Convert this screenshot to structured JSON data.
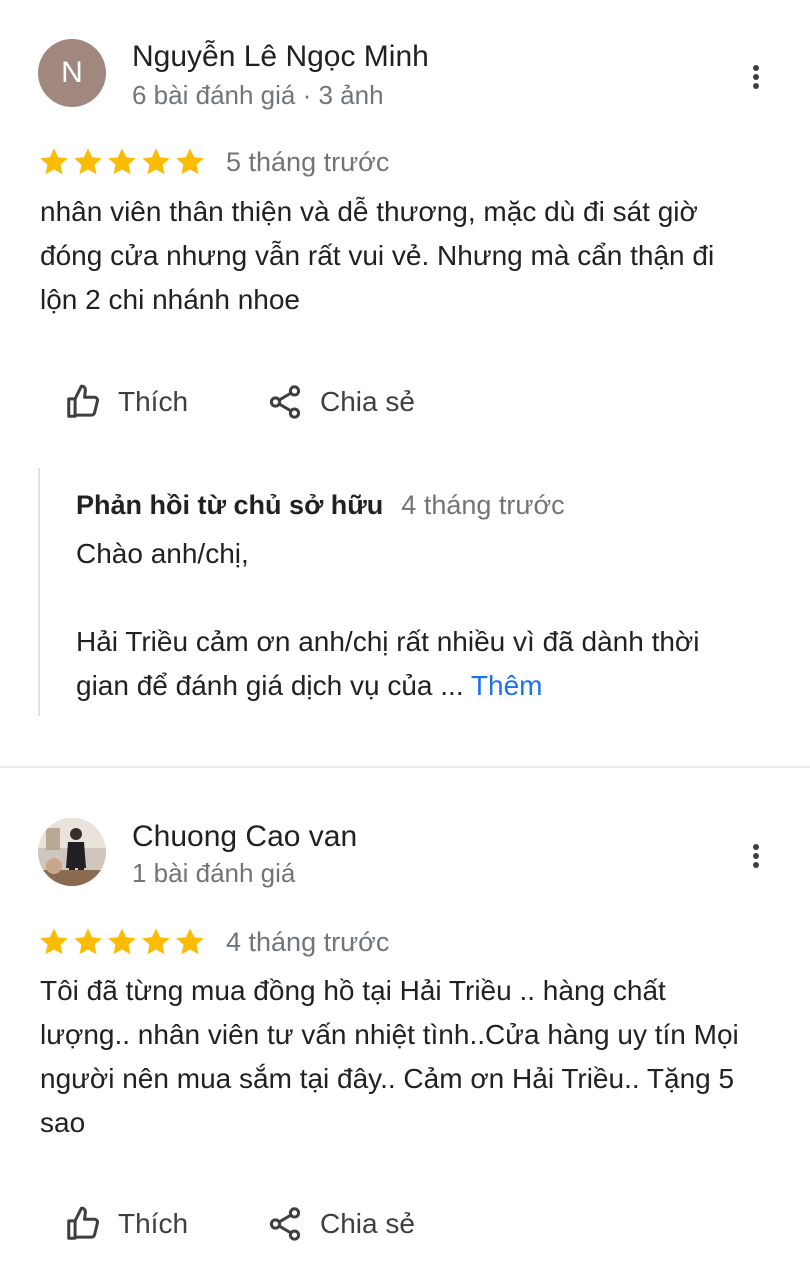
{
  "reviews": [
    {
      "author": "Nguyễn Lê Ngọc Minh",
      "avatar_letter": "N",
      "meta": "6 bài đánh giá · 3 ảnh",
      "rating": 5,
      "time": "5 tháng trước",
      "text_lines": [
        "nhân viên thân thiện và dễ thương, mặc dù đi sát giờ",
        "đóng cửa nhưng vẫn rất vui vẻ. Nhưng mà cẩn thận đi",
        "lộn 2 chi nhánh nhoe"
      ],
      "like_label": "Thích",
      "share_label": "Chia sẻ",
      "owner_reply": {
        "title": "Phản hồi từ chủ sở hữu",
        "time": "4 tháng trước",
        "greeting": "Chào anh/chị,",
        "line1": "Hải Triều cảm ơn anh/chị rất nhiều vì đã dành thời",
        "line2": "gian để đánh giá dịch vụ của ...",
        "more_label": "Thêm"
      }
    },
    {
      "author": "Chuong Cao van",
      "meta": "1 bài đánh giá",
      "rating": 5,
      "time": "4 tháng trước",
      "text_lines": [
        "Tôi đã từng mua đồng hồ tại Hải Triều .. hàng chất",
        "lượng.. nhân viên tư vấn nhiệt tình..Cửa hàng uy tín Mọi",
        "người nên mua sắm tại đây.. Cảm ơn Hải Triều.. Tặng 5",
        "sao"
      ],
      "like_label": "Thích",
      "share_label": "Chia sẻ"
    }
  ],
  "colors": {
    "star": "#fbbc04",
    "link": "#1a73e8",
    "secondary_text": "#70757a",
    "avatar_letter_bg": "#a1887f"
  },
  "icons": [
    "thumbs-up-icon",
    "share-icon",
    "more-vert-icon",
    "star-icon"
  ]
}
